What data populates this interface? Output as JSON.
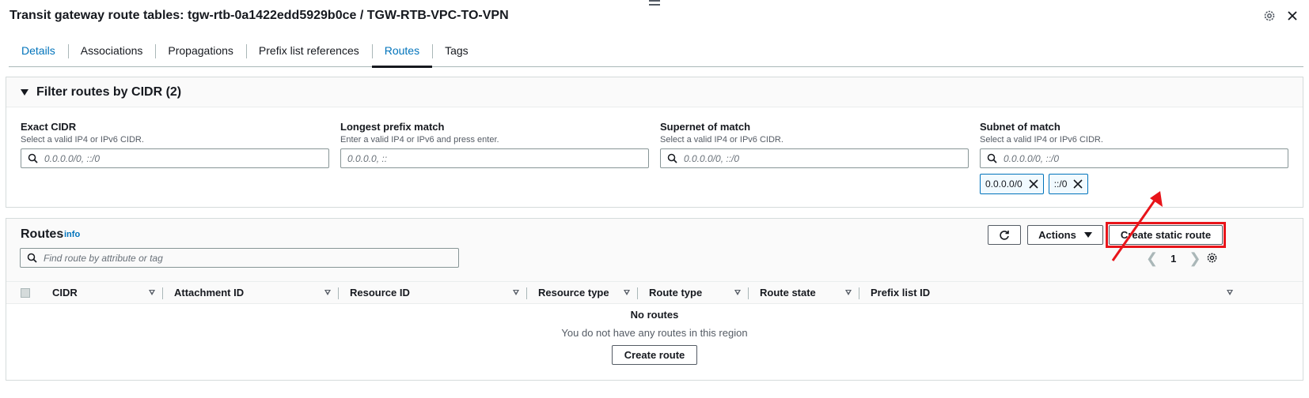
{
  "header": {
    "title": "Transit gateway route tables: tgw-rtb-0a1422edd5929b0ce / TGW-RTB-VPC-TO-VPN",
    "settings_icon": "gear-icon",
    "close_icon": "close-icon"
  },
  "tabs": [
    {
      "label": "Details"
    },
    {
      "label": "Associations"
    },
    {
      "label": "Propagations"
    },
    {
      "label": "Prefix list references"
    },
    {
      "label": "Routes"
    },
    {
      "label": "Tags"
    }
  ],
  "active_tab": "Routes",
  "filter": {
    "title": "Filter routes by CIDR (2)",
    "fields": [
      {
        "label": "Exact CIDR",
        "description": "Select a valid IP4 or IPv6 CIDR.",
        "placeholder": "0.0.0.0/0, ::/0",
        "icon": "search-icon"
      },
      {
        "label": "Longest prefix match",
        "description": "Enter a valid IP4 or IPv6 and press enter.",
        "placeholder": "0.0.0.0, ::"
      },
      {
        "label": "Supernet of match",
        "description": "Select a valid IP4 or IPv6 CIDR.",
        "placeholder": "0.0.0.0/0, ::/0",
        "icon": "search-icon"
      },
      {
        "label": "Subnet of match",
        "description": "Select a valid IP4 or IPv6 CIDR.",
        "placeholder": "0.0.0.0/0, ::/0",
        "icon": "search-icon"
      }
    ],
    "tokens": [
      "0.0.0.0/0",
      "::/0"
    ]
  },
  "routes": {
    "title": "Routes",
    "info": "info",
    "search_placeholder": "Find route by attribute or tag",
    "actions_label": "Actions",
    "create_static_label": "Create static route",
    "page": "1",
    "columns": [
      "CIDR",
      "Attachment ID",
      "Resource ID",
      "Resource type",
      "Route type",
      "Route state",
      "Prefix list ID"
    ],
    "empty_title": "No routes",
    "empty_desc": "You do not have any routes in this region",
    "create_route_label": "Create route"
  },
  "colors": {
    "link": "#0073bb",
    "highlight": "#e8141a"
  }
}
